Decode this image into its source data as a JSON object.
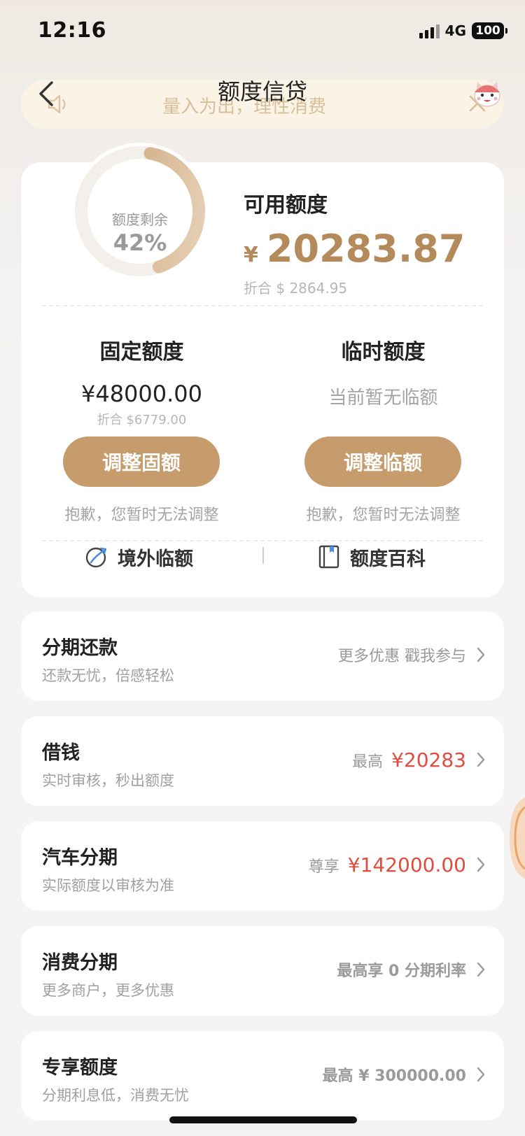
{
  "status_bar": {
    "time": "12:16",
    "network": "4G",
    "battery": "100"
  },
  "nav": {
    "title": "额度信贷"
  },
  "notice": {
    "text": "量入为出，理性消费"
  },
  "summary": {
    "ring_label": "额度剩余",
    "ring_value": "42%",
    "remaining_fraction": 0.42,
    "available_title": "可用额度",
    "available_currency": "¥",
    "available_amount": "20283.87",
    "available_usd": "折合 $ 2864.95"
  },
  "fixed_limit": {
    "title": "固定额度",
    "amount": "¥48000.00",
    "usd": "折合 $6779.00",
    "button": "调整固额",
    "note": "抱歉，您暂时无法调整"
  },
  "temp_limit": {
    "title": "临时额度",
    "status": "当前暂无临额",
    "button": "调整临额",
    "note": "抱歉，您暂时无法调整"
  },
  "links": {
    "overseas": "境外临额",
    "wiki": "额度百科"
  },
  "rows": [
    {
      "title": "分期还款",
      "subtitle": "还款无忧，倍感轻松",
      "right_label": "更多优惠 戳我参与",
      "right_value": ""
    },
    {
      "title": "借钱",
      "subtitle": "实时审核，秒出额度",
      "right_label": "最高",
      "right_value": "¥20283"
    },
    {
      "title": "汽车分期",
      "subtitle": "实际额度以审核为准",
      "right_label": "尊享",
      "right_value": "¥142000.00"
    },
    {
      "title": "消费分期",
      "subtitle": "更多商户，更多优惠",
      "right_label": "最高享 0 分期利率",
      "right_value": ""
    },
    {
      "title": "专享额度",
      "subtitle": "分期利息低，消费无忧",
      "right_label": "最高 ¥ 300000.00",
      "right_value": ""
    }
  ],
  "colors": {
    "accent": "#c69c6d",
    "amount_gold": "#b48a5a",
    "highlight_red": "#e04c3e",
    "notice_bg": "#fbf4e6"
  }
}
